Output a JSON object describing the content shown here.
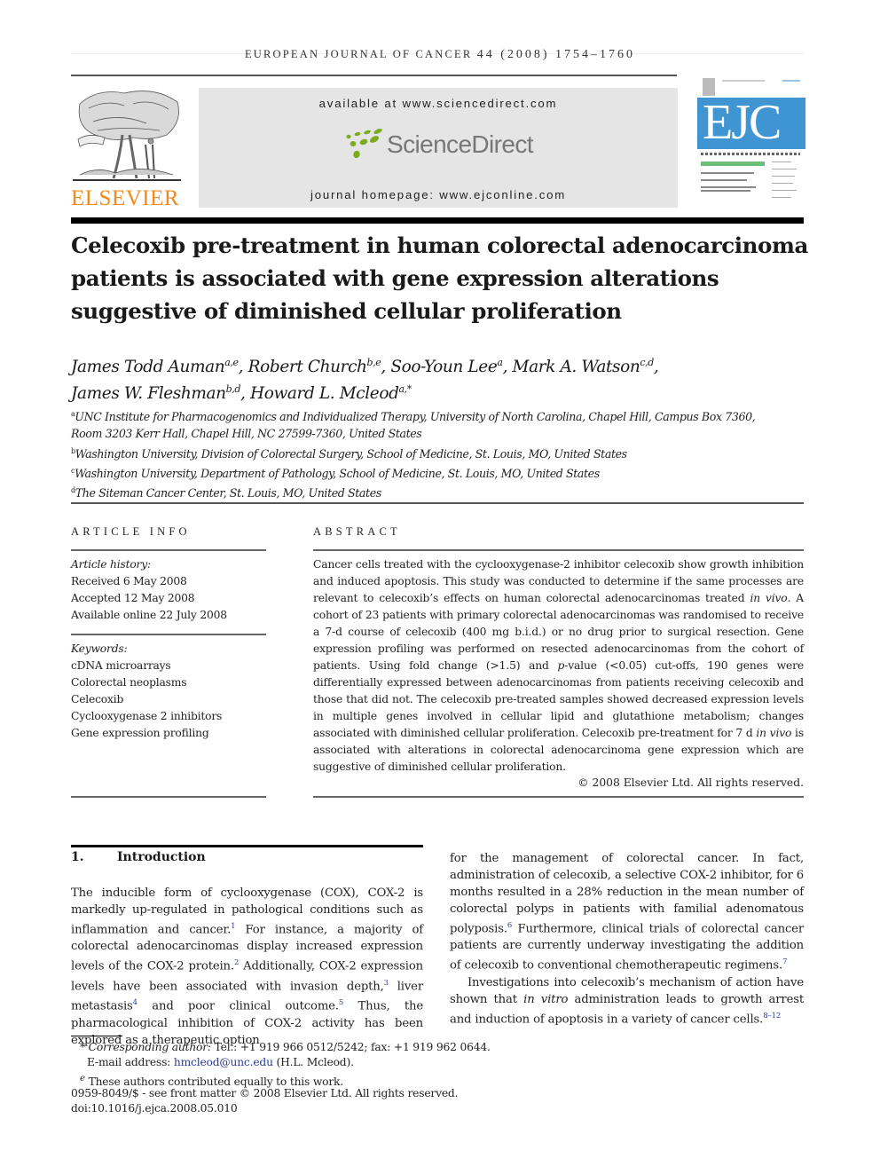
{
  "running_header": {
    "journal": "EUROPEAN JOURNAL OF CANCER",
    "citation": "44 (2008) 1754–1760"
  },
  "banner": {
    "publisher_logo": "ELSEVIER",
    "available_at": "available at www.sciencedirect.com",
    "sciencedirect_logo": "ScienceDirect",
    "journal_homepage": "journal homepage: www.ejconline.com",
    "cover_title": "EJC",
    "brand_colors": {
      "elsevier_orange": "#f08a21",
      "sciencedirect_green": "#7cab1f",
      "ejc_blue": "#3f95d1",
      "banner_gray": "#e5e5e5"
    }
  },
  "article": {
    "title_lines": [
      "Celecoxib pre-treatment in human colorectal adenocarcinoma",
      "patients is associated with gene expression alterations",
      "suggestive of diminished cellular proliferation"
    ],
    "authors": [
      {
        "name": "James Todd Auman",
        "sup": "a,e"
      },
      {
        "name": "Robert Church",
        "sup": "b,e"
      },
      {
        "name": "Soo-Youn Lee",
        "sup": "a"
      },
      {
        "name": "Mark A. Watson",
        "sup": "c,d"
      },
      {
        "name": "James W. Fleshman",
        "sup": "b,d"
      },
      {
        "name": "Howard L. Mcleod",
        "sup": "a,*"
      }
    ],
    "affiliations": [
      {
        "key": "a",
        "line1": "UNC Institute for Pharmacogenomics and Individualized Therapy, University of North Carolina, Chapel Hill, Campus Box 7360,",
        "line2": "Room 3203 Kerr Hall, Chapel Hill, NC 27599-7360, United States"
      },
      {
        "key": "b",
        "line1": "Washington University, Division of Colorectal Surgery, School of Medicine, St. Louis, MO, United States"
      },
      {
        "key": "c",
        "line1": "Washington University, Department of Pathology, School of Medicine, St. Louis, MO, United States"
      },
      {
        "key": "d",
        "line1": "The Siteman Cancer Center, St. Louis, MO, United States"
      }
    ]
  },
  "article_info": {
    "label": "ARTICLE INFO",
    "history_label": "Article history:",
    "history": [
      "Received 6 May 2008",
      "Accepted 12 May 2008",
      "Available online 22 July 2008"
    ],
    "keywords_label": "Keywords:",
    "keywords": [
      "cDNA microarrays",
      "Colorectal neoplasms",
      "Celecoxib",
      "Cyclooxygenase 2 inhibitors",
      "Gene expression profiling"
    ]
  },
  "abstract": {
    "label": "ABSTRACT",
    "text_part1": "Cancer cells treated with the cyclooxygenase-2 inhibitor celecoxib show growth inhibition and induced apoptosis. This study was conducted to determine if the same processes are relevant to celecoxib’s effects on human colorectal adenocarcinomas treated ",
    "italic1": "in vivo",
    "text_part2": ". A cohort of 23 patients with primary colorectal adenocarcinomas was randomised to receive a 7-d course of celecoxib (400 mg b.i.d.) or no drug prior to surgical resection. Gene expression profiling was performed on resected adenocarcinomas from the cohort of patients. Using fold change (>1.5) and ",
    "italic2": "p",
    "text_part3": "-value (<0.05) cut-offs, 190 genes were differentially expressed between adenocarcinomas from patients receiving celecoxib and those that did not. The celecoxib pre-treated samples showed decreased expression levels in multiple genes involved in cellular lipid and glutathione metabolism; changes associated with diminished cellular proliferation. Celecoxib pre-treatment for 7 d ",
    "italic3": "in vivo",
    "text_part4": " is associated with alterations in colorectal adenocarcinoma gene expression which are suggestive of diminished cellular proliferation.",
    "copyright": "© 2008 Elsevier Ltd. All rights reserved."
  },
  "introduction": {
    "number": "1.",
    "heading": "Introduction",
    "left": {
      "t1": "The inducible form of cyclooxygenase (COX), COX-2 is markedly up-regulated in pathological conditions such as inflammation and cancer.",
      "r1": "1",
      "t2": " For instance, a majority of colorectal adenocarcinomas display increased expression levels of the COX-2 protein.",
      "r2": "2",
      "t3": " Additionally, COX-2 expression levels have been associated with invasion depth,",
      "r3": "3",
      "t4": " liver metastasis",
      "r4": "4",
      "t5": " and poor clinical outcome.",
      "r5": "5",
      "t6": " Thus, the pharmacological inhibition of COX-2 activity has been explored as a therapeutic option"
    },
    "right": {
      "t1": "for the management of colorectal cancer. In fact, administration of celecoxib, a selective COX-2 inhibitor, for 6 months resulted in a 28% reduction in the mean number of colorectal polyps in patients with familial adenomatous polyposis.",
      "r6": "6",
      "t2": " Furthermore, clinical trials of colorectal cancer patients are currently underway investigating the addition of celecoxib to conventional chemotherapeutic regimens.",
      "r7": "7",
      "p2_t1": "Investigations into celecoxib’s mechanism of action have shown that ",
      "p2_it": "in vitro",
      "p2_t2": " administration leads to growth arrest and induction of apoptosis in a variety of cancer cells.",
      "r8": "8–12"
    }
  },
  "footnotes": {
    "star": "*",
    "corr_label": "Corresponding author:",
    "corr_text": " Tel.: +1 919 966 0512/5242; fax: +1 919 962 0644.",
    "email_label": "E-mail address: ",
    "email": "hmcleod@unc.edu",
    "email_suffix": " (H.L. Mcleod).",
    "e_mark": "e",
    "e_text": " These authors contributed equally to this work.",
    "front_matter": "0959-8049/$ - see front matter © 2008 Elsevier Ltd. All rights reserved.",
    "doi": "doi:10.1016/j.ejca.2008.05.010"
  }
}
